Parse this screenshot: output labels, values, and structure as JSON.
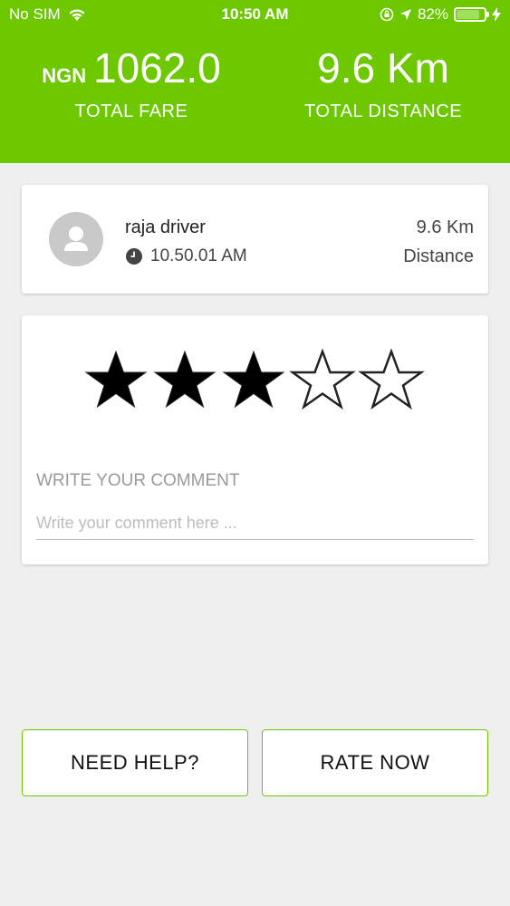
{
  "status_bar": {
    "carrier": "No SIM",
    "time": "10:50 AM",
    "battery": "82%",
    "battery_level": 0.82,
    "icons": [
      "wifi-icon",
      "orientation-lock-icon",
      "location-arrow-icon",
      "battery-icon",
      "charging-icon"
    ]
  },
  "summary": {
    "currency": "NGN",
    "fare": "1062.0",
    "fare_label": "TOTAL FARE",
    "distance": "9.6 Km",
    "distance_label": "TOTAL DISTANCE"
  },
  "driver": {
    "name": "raja driver",
    "time": "10.50.01 AM",
    "distance": "9.6 Km",
    "distance_label": "Distance"
  },
  "rating": {
    "value": 3,
    "max": 5
  },
  "comment": {
    "label": "WRITE YOUR COMMENT",
    "placeholder": "Write your comment here ...",
    "value": ""
  },
  "actions": {
    "help_label": "NEED HELP?",
    "rate_label": "RATE NOW"
  },
  "colors": {
    "accent": "#6dc800",
    "background": "#efefef",
    "star_filled": "#000000",
    "placeholder": "#bdbdbd"
  }
}
